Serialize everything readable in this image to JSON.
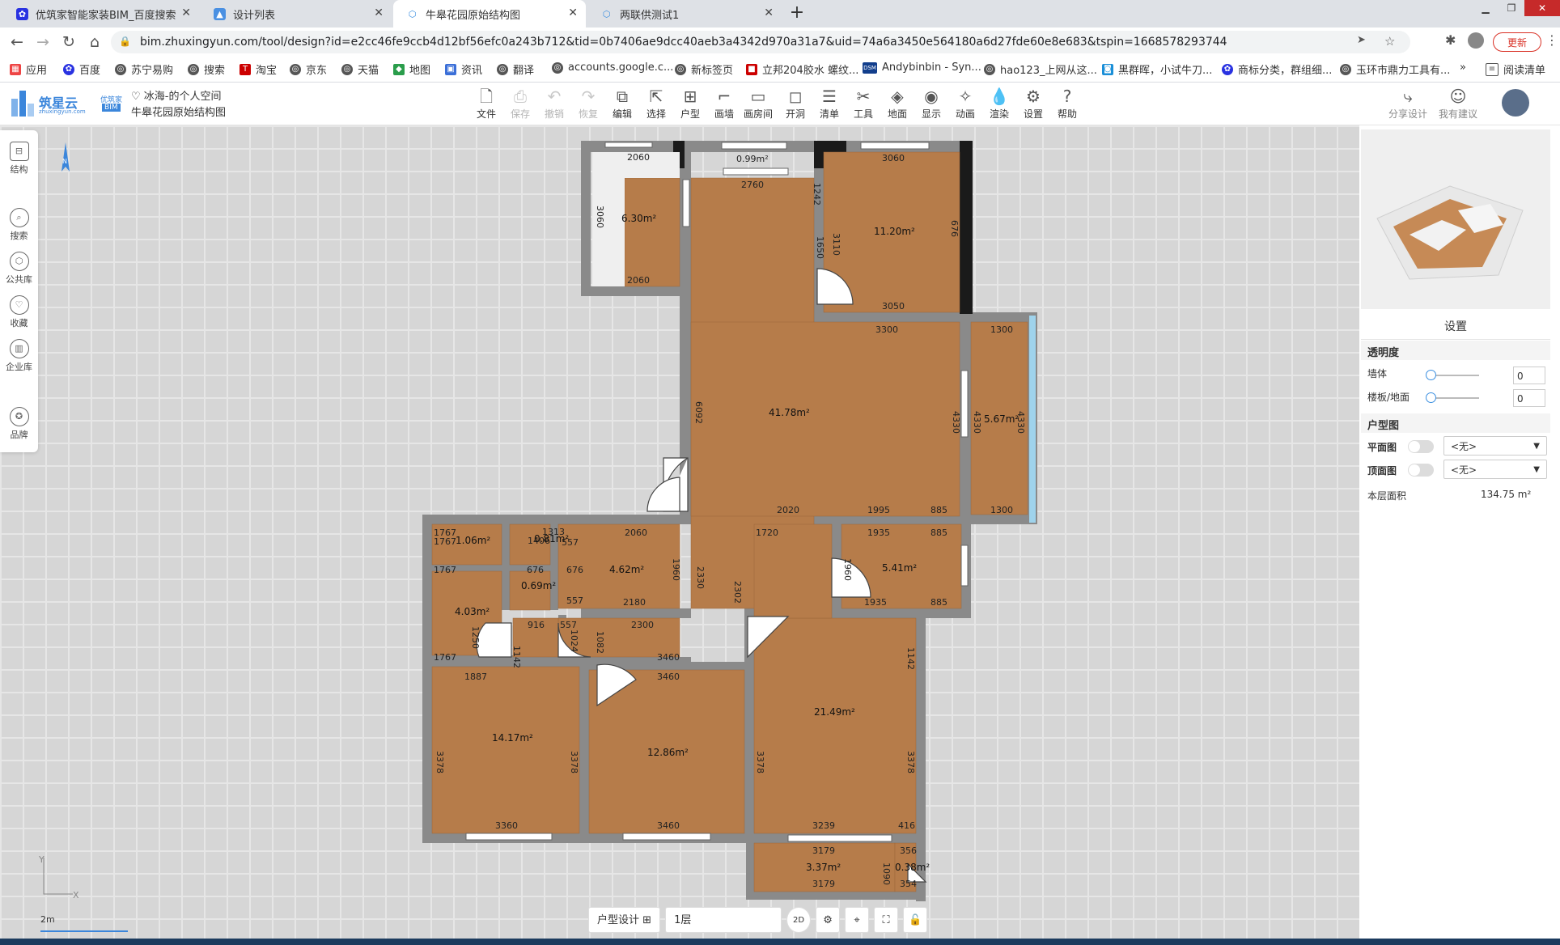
{
  "browser": {
    "tabs": [
      {
        "label": "优筑家智能家装BIM_百度搜索",
        "icon": "baidu-paw-icon",
        "active": false
      },
      {
        "label": "设计列表",
        "icon": "page-icon",
        "active": false
      },
      {
        "label": "牛皋花园原始结构图",
        "icon": "cube-icon",
        "active": true
      },
      {
        "label": "两联供测试1",
        "icon": "cube-icon",
        "active": false
      }
    ],
    "url": "bim.zhuxingyun.com/tool/design?id=e2cc46fe9ccb4d12bf56efc0a243b712&tid=0b7406ae9dcc40aeb3a4342d970a31a7&uid=74a6a3450e564180a6d27fde60e8e683&tspin=1668578293744",
    "update_label": "更新",
    "bookmarks": [
      "应用",
      "百度",
      "苏宁易购",
      "搜索",
      "淘宝",
      "京东",
      "天猫",
      "地图",
      "资讯",
      "翻译",
      "accounts.google.c...",
      "新标签页",
      "立邦204胶水 螺纹...",
      "Andybinbin - Syn...",
      "hao123_上网从这...",
      "黑群晖，小试牛刀...",
      "商标分类，群组细...",
      "玉环市鼎力工具有..."
    ],
    "reading_list": "阅读清单"
  },
  "app": {
    "logo": "筑星云",
    "logo_sub": "zhuxingyun.com",
    "brand_top": "优筑家",
    "brand_bottom": "BIM",
    "space_label": "冰海-的个人空间",
    "project_title": "牛皋花园原始结构图",
    "toolbar": [
      "文件",
      "保存",
      "撤销",
      "恢复",
      "编辑",
      "选择",
      "户型",
      "画墙",
      "画房间",
      "开洞",
      "清单",
      "工具",
      "地面",
      "显示",
      "动画",
      "渲染",
      "设置",
      "帮助"
    ],
    "share_label": "分享设计",
    "suggest_label": "我有建议"
  },
  "sidebar": [
    "结构",
    "搜索",
    "公共库",
    "收藏",
    "企业库",
    "品牌"
  ],
  "floorplan": {
    "rooms": [
      {
        "label": "6.30m²"
      },
      {
        "label": "11.20m²"
      },
      {
        "label": "41.78m²"
      },
      {
        "label": "5.67m²"
      },
      {
        "label": "1.06m²"
      },
      {
        "label": "0.81m²"
      },
      {
        "label": "4.62m²"
      },
      {
        "label": "5.41m²"
      },
      {
        "label": "0.69m²"
      },
      {
        "label": "4.03m²"
      },
      {
        "label": "14.17m²"
      },
      {
        "label": "12.86m²"
      },
      {
        "label": "21.49m²"
      },
      {
        "label": "3.37m²"
      },
      {
        "label": "0.38m²"
      }
    ],
    "dims": [
      "2060",
      "0.99m²",
      "3060",
      "2760",
      "3060",
      "2060",
      "3050",
      "3300",
      "1300",
      "2020",
      "1995",
      "885",
      "1300",
      "2060",
      "1720",
      "1935",
      "885",
      "1767",
      "1767",
      "2180",
      "1935",
      "885",
      "2300",
      "3460",
      "1767",
      "1887",
      "3460",
      "3360",
      "3460",
      "3239",
      "416",
      "3179",
      "3179",
      "356",
      "354",
      "916",
      "557",
      "676",
      "676",
      "676",
      "557",
      "1406",
      "1313",
      "1767",
      "557",
      "1142",
      "1142",
      "3378",
      "3378",
      "3378",
      "3378",
      "6092",
      "4330",
      "4330",
      "4330",
      "1960",
      "1024",
      "1082",
      "1250",
      "1090",
      "1960",
      "2302",
      "2330",
      "1242",
      "3110",
      "1650"
    ],
    "scale_label": "2m",
    "axis_y": "Y",
    "axis_x": "X",
    "compass": "N"
  },
  "panel": {
    "title": "设置",
    "transparency_label": "透明度",
    "wall_label": "墙体",
    "wall_value": "0",
    "floor_label": "楼板/地面",
    "floor_value": "0",
    "plan_section": "户型图",
    "plan_label": "平面图",
    "plan_select": "<无>",
    "ceiling_label": "顶面图",
    "ceiling_select": "<无>",
    "area_label": "本层面积",
    "area_value": "134.75 m²"
  },
  "bottom": {
    "design_label": "户型设计",
    "floor_label": "1层",
    "view_2d": "2D"
  }
}
